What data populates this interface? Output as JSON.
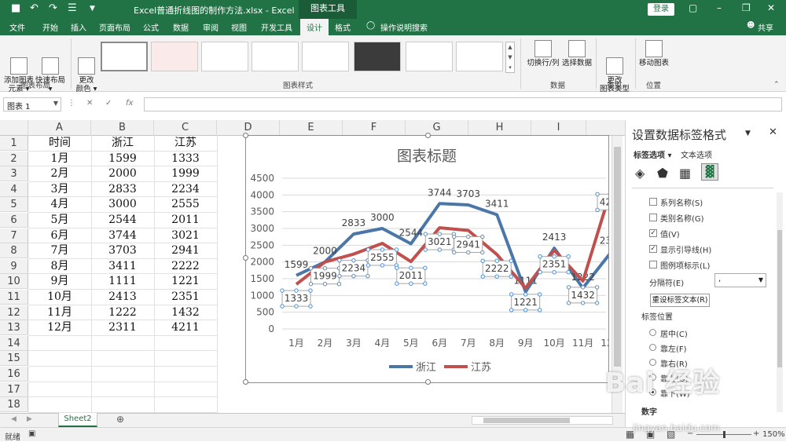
{
  "title_bar": {
    "doc_title": "Excel普通折线图的制作方法.xlsx  -  Excel",
    "context_tab": "图表工具",
    "login": "登录"
  },
  "tabs": [
    {
      "label": "文件"
    },
    {
      "label": "开始"
    },
    {
      "label": "插入"
    },
    {
      "label": "页面布局"
    },
    {
      "label": "公式"
    },
    {
      "label": "数据"
    },
    {
      "label": "审阅"
    },
    {
      "label": "视图"
    },
    {
      "label": "开发工具"
    },
    {
      "label": "设计"
    },
    {
      "label": "格式"
    }
  ],
  "tell_me": "操作说明搜索",
  "share": "共享",
  "ribbon": {
    "add_element": "添加图表\n元素 ▾",
    "quick_layout": "快速布局\n▾",
    "change_color": "更改\n颜色 ▾",
    "switch_row_col": "切换行/列",
    "select_data": "选择数据",
    "change_type": "更改\n图表类型",
    "move_chart": "移动图表",
    "groups": {
      "layout": "图表布局",
      "styles": "图表样式",
      "data": "数据",
      "type": "类型",
      "location": "位置"
    }
  },
  "name_box": "图表 1",
  "columns": [
    "A",
    "B",
    "C",
    "D",
    "E",
    "F",
    "G",
    "H",
    "I"
  ],
  "rows": [
    "1",
    "2",
    "3",
    "4",
    "5",
    "6",
    "7",
    "8",
    "9",
    "10",
    "11",
    "12",
    "13",
    "14",
    "15",
    "16",
    "17",
    "18"
  ],
  "table": {
    "header": [
      "时间",
      "浙江",
      "江苏"
    ],
    "body": [
      [
        "1月",
        "1599",
        "1333"
      ],
      [
        "2月",
        "2000",
        "1999"
      ],
      [
        "3月",
        "2833",
        "2234"
      ],
      [
        "4月",
        "3000",
        "2555"
      ],
      [
        "5月",
        "2544",
        "2011"
      ],
      [
        "6月",
        "3744",
        "3021"
      ],
      [
        "7月",
        "3703",
        "2941"
      ],
      [
        "8月",
        "3411",
        "2222"
      ],
      [
        "9月",
        "1111",
        "1221"
      ],
      [
        "10月",
        "2413",
        "2351"
      ],
      [
        "11月",
        "1222",
        "1432"
      ],
      [
        "12月",
        "2311",
        "4211"
      ]
    ]
  },
  "chart_data": {
    "type": "line",
    "title": "图表标题",
    "categories": [
      "1月",
      "2月",
      "3月",
      "4月",
      "5月",
      "6月",
      "7月",
      "8月",
      "9月",
      "10月",
      "11月",
      "12月"
    ],
    "series": [
      {
        "name": "浙江",
        "color": "#4a76a8",
        "values": [
          1599,
          2000,
          2833,
          3000,
          2544,
          3744,
          3703,
          3411,
          1111,
          2413,
          1222,
          2311
        ]
      },
      {
        "name": "江苏",
        "color": "#c0504d",
        "values": [
          1333,
          1999,
          2234,
          2555,
          2011,
          3021,
          2941,
          2222,
          1221,
          2351,
          1432,
          4211
        ]
      }
    ],
    "y_ticks": [
      "0",
      "500",
      "1000",
      "1500",
      "2000",
      "2500",
      "3000",
      "3500",
      "4000",
      "4500"
    ],
    "ylim": [
      0,
      4500
    ],
    "grid": true,
    "legend": "bottom"
  },
  "sheet_tab": "Sheet2",
  "status": {
    "ready": "就绪",
    "zoom": "150%"
  },
  "pane": {
    "title": "设置数据标签格式",
    "tab_label_options": "标签选项 ▾",
    "tab_text_options": "文本选项",
    "checkboxes": [
      {
        "label": "系列名称(S)",
        "checked": ""
      },
      {
        "label": "类别名称(G)",
        "checked": ""
      },
      {
        "label": "值(V)",
        "checked": "✓"
      },
      {
        "label": "显示引导线(H)",
        "checked": "✓"
      },
      {
        "label": "图例项标示(L)",
        "checked": ""
      }
    ],
    "separator_label": "分隔符(E)",
    "separator_value": ",",
    "reset_button": "重设标签文本(R)",
    "position_label": "标签位置",
    "radios": [
      {
        "label": "居中(C)"
      },
      {
        "label": "靠左(F)"
      },
      {
        "label": "靠右(R)"
      },
      {
        "label": "靠上(O)"
      },
      {
        "label": "靠下(W)"
      }
    ],
    "number_label": "数字"
  },
  "watermark": {
    "main": "Bai 经验",
    "sub": "jingyan.baidu.com"
  }
}
